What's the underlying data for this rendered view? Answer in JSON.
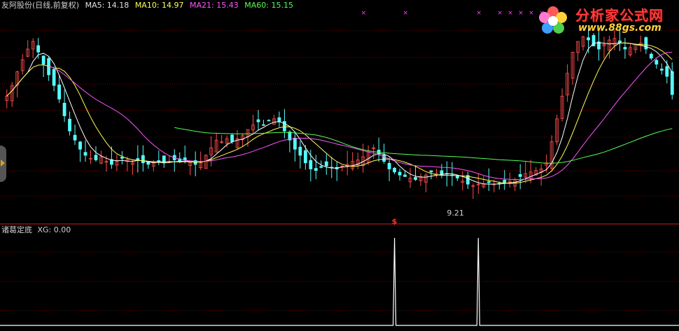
{
  "header": {
    "title": "友阿股份(日线,前复权)",
    "ma5": "MA5: 14.18",
    "ma10": "MA10: 14.97",
    "ma21": "MA21: 15.43",
    "ma60": "MA60: 15.15"
  },
  "sub_header": {
    "indicator": "诸葛定底",
    "value": "XG: 0.00"
  },
  "annotations": {
    "low_price": "9.21",
    "signal_mark": "$"
  },
  "logo": {
    "title": "分析家公式网",
    "url": "www.88gs.com",
    "icon": "flower-icon"
  },
  "colors": {
    "background": "#000000",
    "grid": "#7a0000",
    "separator": "#c81e1e",
    "candle_up": "#ff4d4d",
    "candle_down": "#54ffff",
    "ma5": "#ffffff",
    "ma10": "#ffff55",
    "ma21": "#ff55ff",
    "ma60": "#55ff55",
    "signal": "#ffffff",
    "markers": "#ff40ff"
  },
  "chart_data": [
    {
      "type": "candlestick",
      "title": "友阿股份(日线,前复权)",
      "y_range": [
        9.0,
        22.0
      ],
      "grid": true,
      "close": [
        16.5,
        17.2,
        18.1,
        18.9,
        19.6,
        20.1,
        19.4,
        18.6,
        17.9,
        17.2,
        16.3,
        15.2,
        14.2,
        13.6,
        13.0,
        12.6,
        12.4,
        12.3,
        12.5,
        12.2,
        12.0,
        12.2,
        12.4,
        12.3,
        12.1,
        12.3,
        12.1,
        12.0,
        12.1,
        12.2,
        12.1,
        12.2,
        12.3,
        12.2,
        12.3,
        12.1,
        12.0,
        12.1,
        12.6,
        13.1,
        13.6,
        13.5,
        13.7,
        13.5,
        13.7,
        13.9,
        14.3,
        14.6,
        14.8,
        14.6,
        14.9,
        15.0,
        14.8,
        14.2,
        13.6,
        13.0,
        12.6,
        12.1,
        11.7,
        11.6,
        11.8,
        11.9,
        11.8,
        11.7,
        11.9,
        12.0,
        12.2,
        12.3,
        12.5,
        12.9,
        13.1,
        12.7,
        12.2,
        11.7,
        11.5,
        11.3,
        11.2,
        11.1,
        11.0,
        11.2,
        11.3,
        11.5,
        11.4,
        11.3,
        11.4,
        11.3,
        11.1,
        10.9,
        10.7,
        10.6,
        10.7,
        10.7,
        10.8,
        10.7,
        10.7,
        10.8,
        10.9,
        11.0,
        11.2,
        11.4,
        11.5,
        11.6,
        11.7,
        12.1,
        13.5,
        15.0,
        16.5,
        18.0,
        19.4,
        20.1,
        20.4,
        20.2,
        19.8,
        19.6,
        19.9,
        20.2,
        20.3,
        20.0,
        19.6,
        19.7,
        19.9,
        20.0,
        19.6,
        19.0,
        18.6,
        18.2,
        17.8,
        16.6
      ],
      "series": [
        {
          "name": "MA5",
          "value": 14.18
        },
        {
          "name": "MA10",
          "value": 14.97
        },
        {
          "name": "MA21",
          "value": 15.43
        },
        {
          "name": "MA60",
          "value": 15.15
        }
      ],
      "annotations": [
        {
          "text": "9.21",
          "note": "period low"
        }
      ]
    },
    {
      "type": "line",
      "title": "诸葛定底",
      "series": [
        {
          "name": "XG",
          "value": 0.0
        }
      ],
      "y_range": [
        0,
        1
      ],
      "signal_indices": [
        74,
        90
      ]
    }
  ]
}
